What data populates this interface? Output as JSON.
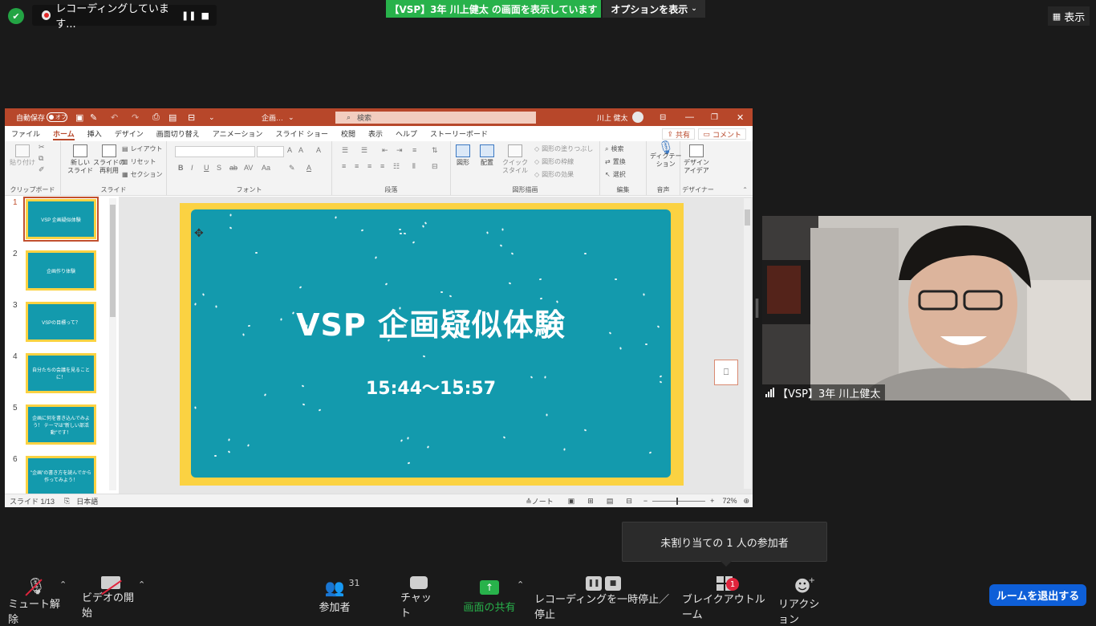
{
  "zoom": {
    "recording_text": "レコーディングしています...",
    "share_banner": "【VSP】3年 川上健太 の画面を表示しています",
    "options_button": "オプションを表示",
    "view_button": "表示",
    "tooltip": "未割り当ての 1 人の参加者",
    "participants_count": "31",
    "breakout_badge": "1",
    "leave_button": "ルームを退出する",
    "controls": [
      {
        "label": "ミュート解除",
        "icon": "mic-off-icon"
      },
      {
        "label": "ビデオの開始",
        "icon": "video-off-icon"
      },
      {
        "label": "参加者",
        "icon": "participants-icon"
      },
      {
        "label": "チャット",
        "icon": "chat-icon"
      },
      {
        "label": "画面の共有",
        "icon": "share-screen-icon"
      },
      {
        "label": "レコーディングを一時停止／停止",
        "icon": "recording-controls-icon"
      },
      {
        "label": "ブレイクアウトルーム",
        "icon": "breakout-icon"
      },
      {
        "label": "リアクション",
        "icon": "reaction-icon"
      }
    ],
    "colors": {
      "share_green": "#28b24b",
      "leave_blue": "#0e5fd8",
      "badge_red": "#e0243c"
    }
  },
  "ppt": {
    "autosave_label": "自動保存",
    "autosave_state": "オフ",
    "file_name": "企画…",
    "search_placeholder": "検索",
    "user_name": "川上 健太",
    "menus": [
      "ファイル",
      "ホーム",
      "挿入",
      "デザイン",
      "画面切り替え",
      "アニメーション",
      "スライド ショー",
      "校閲",
      "表示",
      "ヘルプ",
      "ストーリーボード"
    ],
    "active_menu": "ホーム",
    "share_label": "共有",
    "comment_label": "コメント",
    "ribbon": {
      "clipboard": "クリップボード",
      "paste": "貼り付け",
      "slide_group": "スライド",
      "new_slide": "新しい\nスライド",
      "reuse_slide": "スライドの\n再利用",
      "layout": "レイアウト",
      "reset": "リセット",
      "section": "セクション",
      "font_group": "フォント",
      "paragraph_group": "段落",
      "drawing_group": "図形描画",
      "shape": "図形",
      "arrange": "配置",
      "quick_style": "クイック\nスタイル",
      "shape_fill": "図形の塗りつぶし",
      "shape_outline": "図形の枠線",
      "shape_effect": "図形の効果",
      "editing_group": "編集",
      "find": "検索",
      "replace": "置換",
      "select": "選択",
      "voice_group": "音声",
      "dictate": "ディクテー\nション",
      "designer_group": "デザイナー",
      "design_ideas": "デザイン\nアイデア"
    },
    "thumbnails": [
      {
        "num": "1",
        "text": "VSP 企画疑似体験"
      },
      {
        "num": "2",
        "text": "企画作り体験"
      },
      {
        "num": "3",
        "text": "VSPの目標って？"
      },
      {
        "num": "4",
        "text": "自分たちの会議を見ることに！"
      },
      {
        "num": "5",
        "text": "企画に何を書き込んでみよう！ テーマは\"新しい部活動\"です！"
      },
      {
        "num": "6",
        "text": "\"企画\"の書き方を読んでから 作ってみよう！"
      }
    ],
    "slide": {
      "title": "VSP 企画疑似体験",
      "subtitle": "15:44〜15:57"
    },
    "status": {
      "slide_indicator": "スライド 1/13",
      "language": "日本語",
      "notes": "ノート",
      "zoom": "72%"
    }
  },
  "video": {
    "name": "【VSP】3年 川上健太"
  }
}
